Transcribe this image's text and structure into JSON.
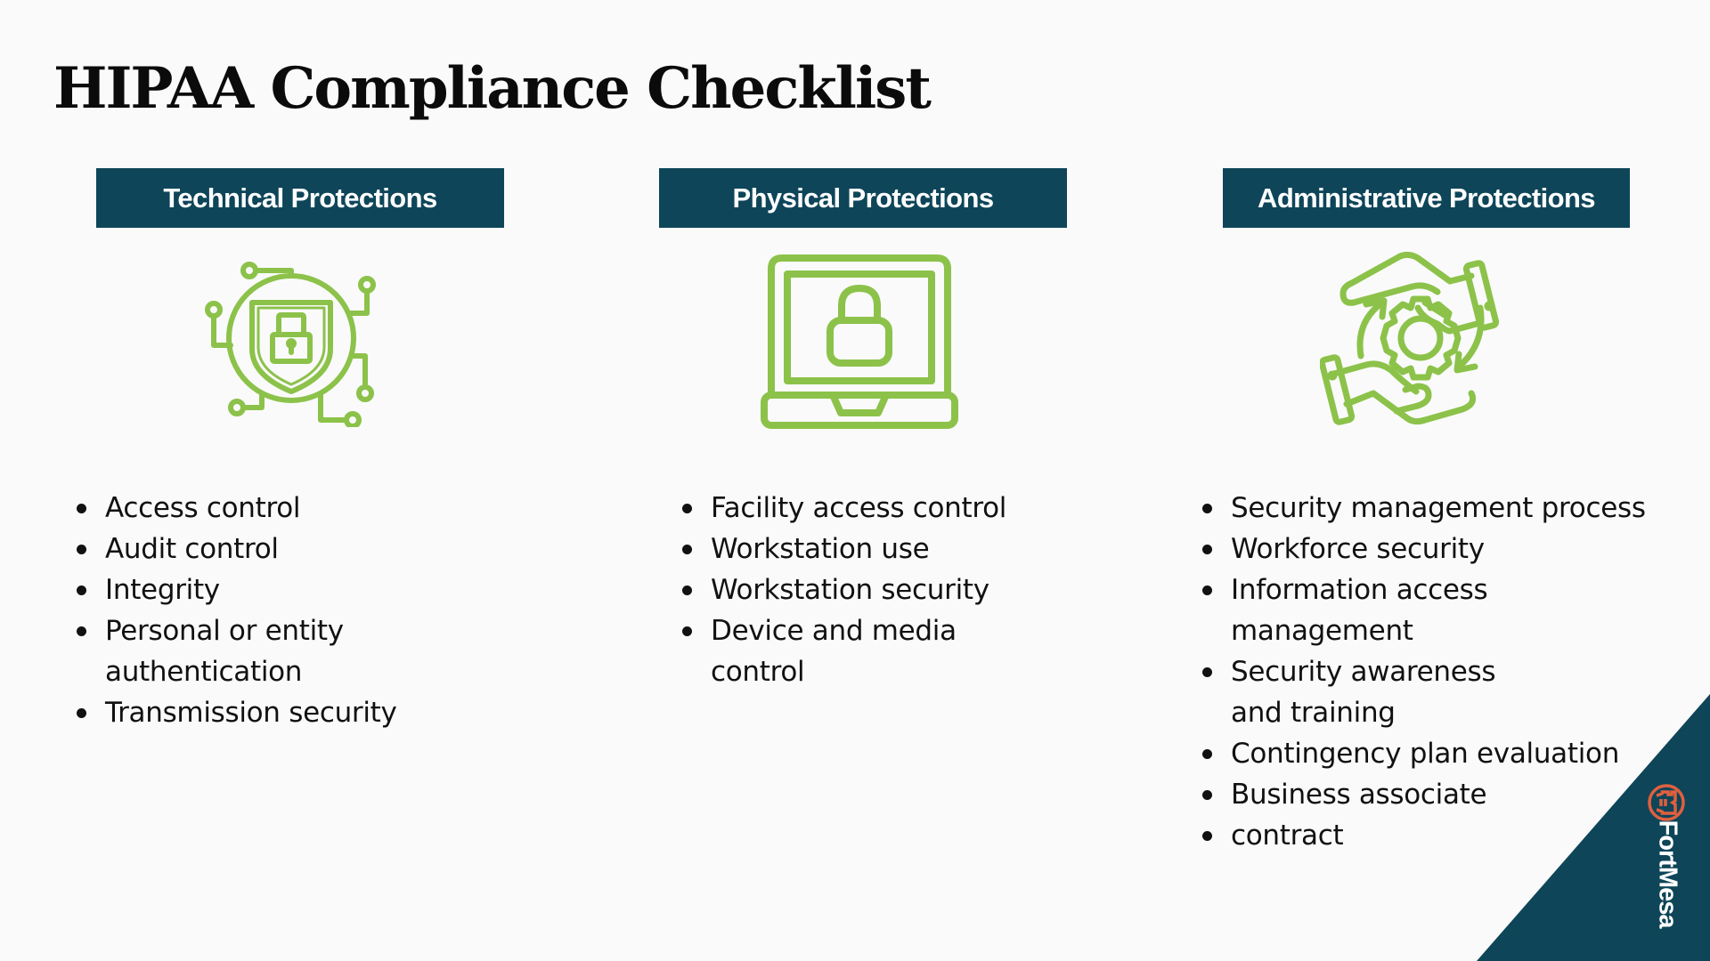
{
  "page": {
    "title": "HIPAA Compliance Checklist"
  },
  "colors": {
    "background": "#fafafa",
    "navy": "#0e4559",
    "green": "#8cc24a",
    "logo_orange": "#e0603f"
  },
  "columns": [
    {
      "header": "Technical Protections",
      "icon": "shield-lock-circuit-icon",
      "items": [
        "Access control",
        "Audit control",
        "Integrity",
        "Personal or entity authentication",
        "Transmission security"
      ]
    },
    {
      "header": "Physical Protections",
      "icon": "laptop-lock-icon",
      "items": [
        "Facility access control",
        "Workstation use",
        "Workstation security",
        "Device and media control"
      ]
    },
    {
      "header": "Administrative Protections",
      "icon": "hands-gear-icon",
      "items": [
        "Security management process",
        "Workforce security",
        "Information access management",
        "Security awareness and training",
        "Contingency plan evaluation",
        "Business associate",
        "contract"
      ]
    }
  ],
  "brand": {
    "name": "FortMesa",
    "icon": "fort-tower-logo-icon"
  }
}
